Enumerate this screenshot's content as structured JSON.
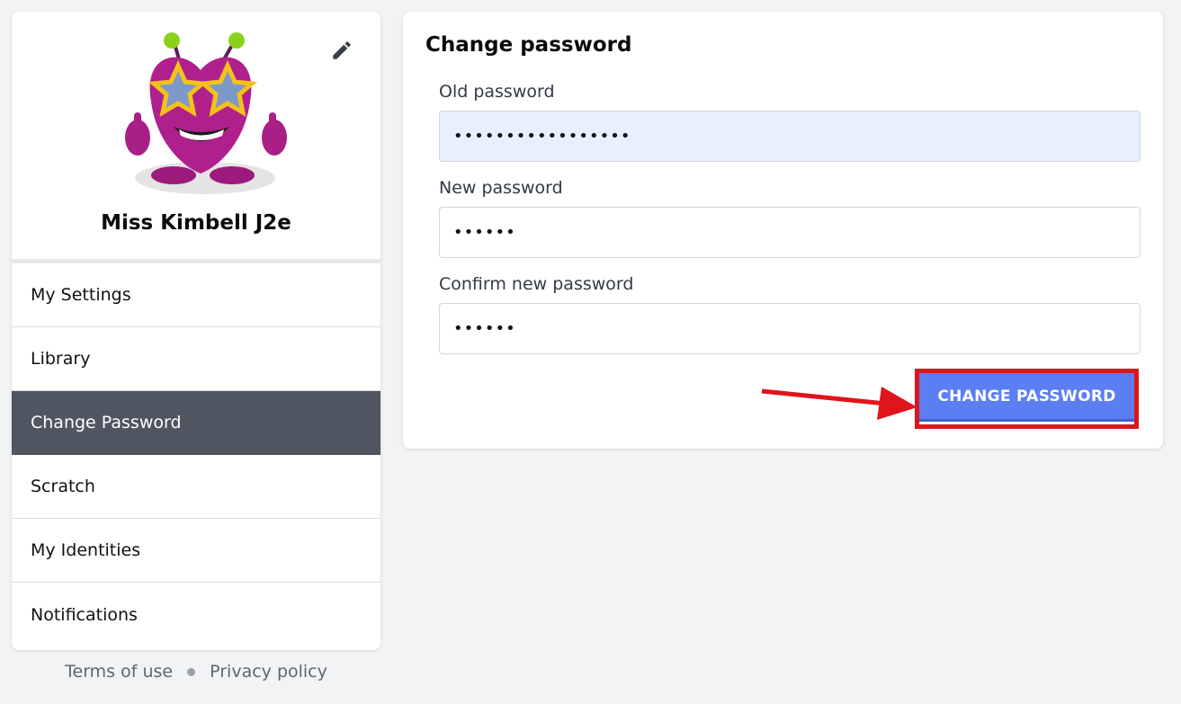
{
  "profile": {
    "name": "Miss Kimbell J2e",
    "avatar_icon": "purple-monster-star-glasses-avatar",
    "edit_icon": "pencil-icon"
  },
  "sidebar": {
    "items": [
      {
        "label": "My Settings",
        "active": false
      },
      {
        "label": "Library",
        "active": false
      },
      {
        "label": "Change Password",
        "active": true
      },
      {
        "label": "Scratch",
        "active": false
      },
      {
        "label": "My Identities",
        "active": false
      },
      {
        "label": "Notifications",
        "active": false
      }
    ]
  },
  "footer": {
    "terms_label": "Terms of use",
    "privacy_label": "Privacy policy"
  },
  "change_password": {
    "title": "Change password",
    "old_password": {
      "label": "Old password",
      "value": "•••••••••••••••••"
    },
    "new_password": {
      "label": "New password",
      "value": "••••••"
    },
    "confirm_password": {
      "label": "Confirm new password",
      "value": "••••••"
    },
    "submit_label": "CHANGE PASSWORD"
  },
  "colors": {
    "accent": "#5b7ff3",
    "highlight": "#e0141b",
    "active_nav": "#4f5561",
    "autofill_bg": "#e8f0fe"
  }
}
